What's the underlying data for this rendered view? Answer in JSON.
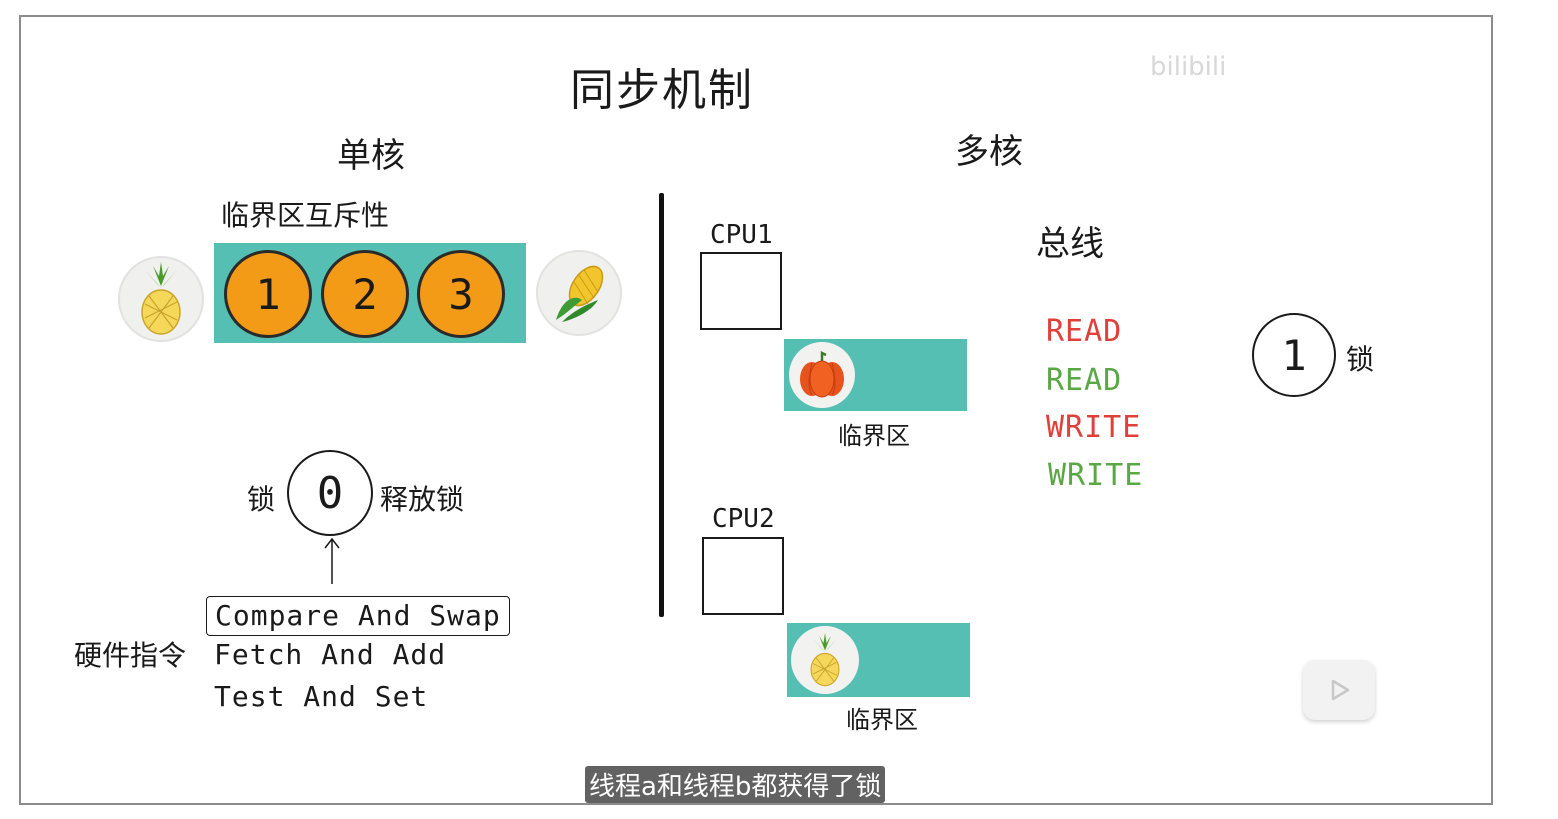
{
  "title": "同步机制",
  "watermark": "bilibili",
  "single_core": {
    "heading": "单核",
    "critical_label": "临界区互斥性",
    "slots": [
      "1",
      "2",
      "3"
    ],
    "lock_label": "锁",
    "lock_value": "0",
    "release_label": "释放锁",
    "hardware_label": "硬件指令",
    "instructions": [
      "Compare And Swap",
      "Fetch And Add",
      "Test And Set"
    ]
  },
  "multi_core": {
    "heading": "多核",
    "cpu1": "CPU1",
    "cpu2": "CPU2",
    "critical1": "临界区",
    "critical2": "临界区",
    "bus_label": "总线",
    "ops": [
      {
        "text": "READ",
        "color": "#e0403a"
      },
      {
        "text": "READ",
        "color": "#5aa845"
      },
      {
        "text": "WRITE",
        "color": "#e0403a"
      },
      {
        "text": "WRITE",
        "color": "#5aa845"
      }
    ],
    "lock_value": "1",
    "lock_label": "锁"
  },
  "subtitle": "线程a和线程b都获得了锁",
  "colors": {
    "teal": "#56bfb3",
    "orange": "#f39a17",
    "frame_border": "#8c8c8c"
  },
  "icons": [
    "pineapple-icon",
    "corn-icon",
    "pumpkin-icon",
    "play-icon"
  ]
}
